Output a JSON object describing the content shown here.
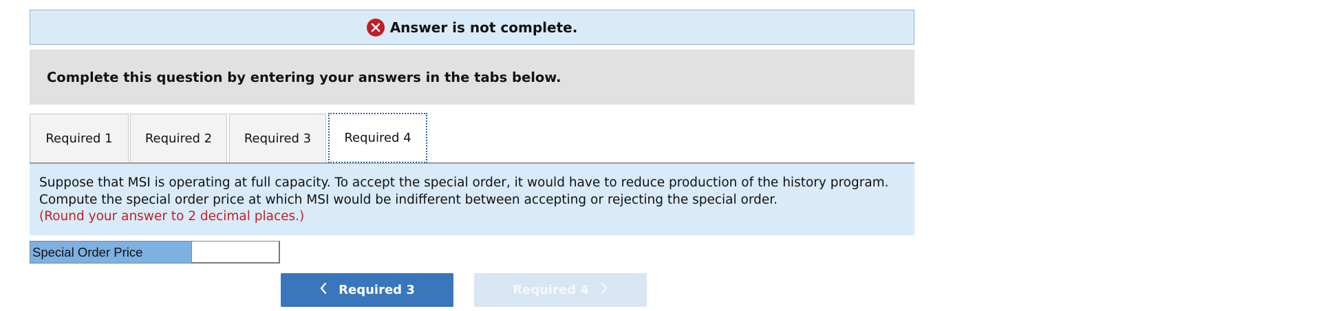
{
  "banner": {
    "status_icon": "error-x-icon",
    "status_color": "#c01f25",
    "message": "Answer is not complete."
  },
  "instructions": "Complete this question by entering your answers in the tabs below.",
  "tabs": [
    {
      "label": "Required 1",
      "active": false
    },
    {
      "label": "Required 2",
      "active": false
    },
    {
      "label": "Required 3",
      "active": false
    },
    {
      "label": "Required 4",
      "active": true
    }
  ],
  "question": {
    "text": "Suppose that MSI is operating at full capacity. To accept the special order, it would have to reduce production of the history program. Compute the special order price at which MSI would be indifferent between accepting or rejecting the special order.",
    "rounding_note": "(Round your answer to 2 decimal places.)"
  },
  "answer": {
    "label": "Special Order Price",
    "value": ""
  },
  "navigation": {
    "prev_label": "Required 3",
    "prev_icon": "chevron-left-icon",
    "next_label": "Required 4",
    "next_icon": "chevron-right-icon",
    "next_disabled": true
  },
  "colors": {
    "accent": "#3a76bb",
    "panel_bg": "#d9ebf9",
    "label_bg": "#7eb0e1"
  }
}
